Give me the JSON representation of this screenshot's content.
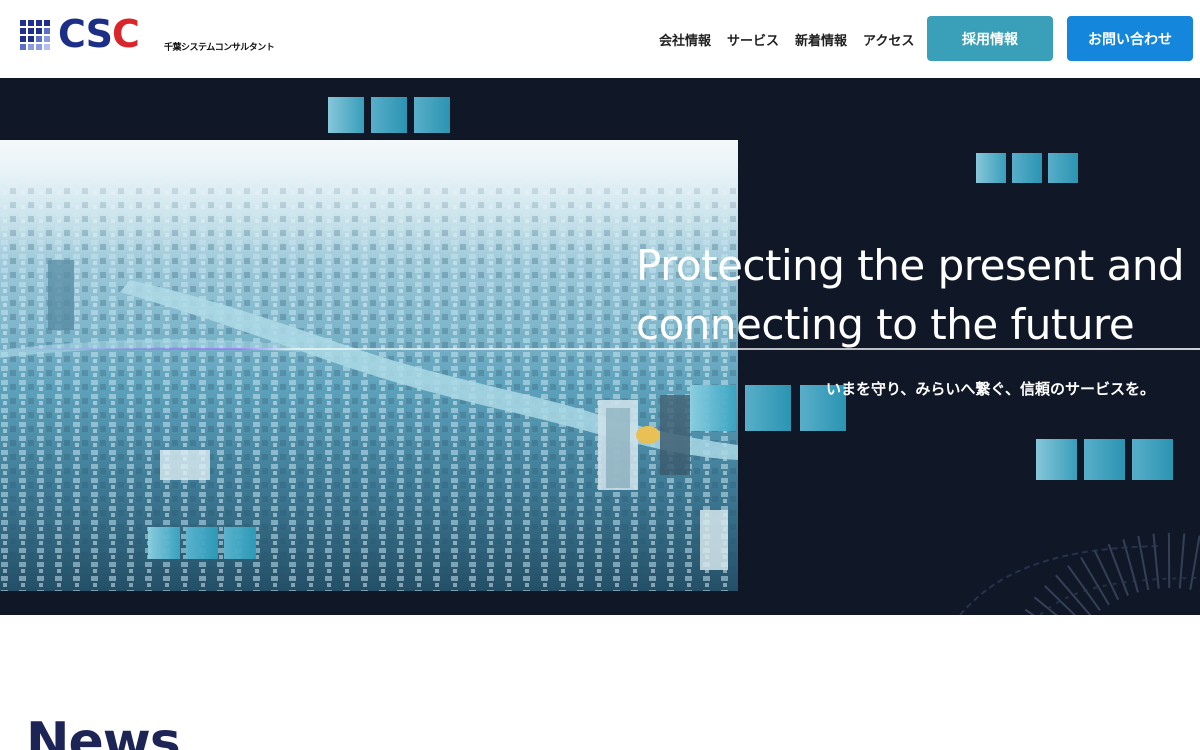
{
  "header": {
    "logo_text_main": "CS",
    "logo_text_accent": "C",
    "logo_subtitle": "千葉システムコンサルタント",
    "nav": [
      {
        "label": "会社情報"
      },
      {
        "label": "サービス"
      },
      {
        "label": "新着情報"
      },
      {
        "label": "アクセス"
      }
    ],
    "recruit_label": "採用情報",
    "contact_label": "お問い合わせ"
  },
  "hero": {
    "title_line1": "Protecting the present and",
    "title_line2": "connecting to the future",
    "subtitle": "いまを守り、みらいへ繋ぐ、信頼のサービスを。"
  },
  "news": {
    "heading": "News"
  },
  "colors": {
    "brand_navy": "#1d2e86",
    "brand_red": "#d9262d",
    "recruit_button": "#3a9fb8",
    "contact_button": "#1486dc",
    "hero_background": "#101827",
    "accent_squares": "#2c9bb9"
  }
}
